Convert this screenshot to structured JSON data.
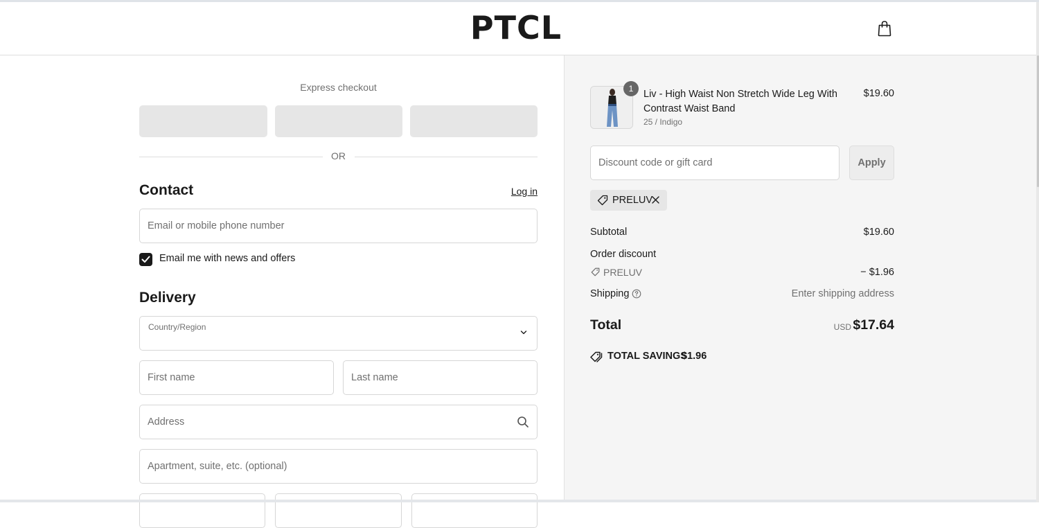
{
  "header": {
    "logo": "PTCL",
    "cart_icon": "shopping-bag-icon"
  },
  "express": {
    "label": "Express checkout",
    "or": "OR"
  },
  "contact": {
    "title": "Contact",
    "login": "Log in",
    "email_placeholder": "Email or mobile phone number",
    "newsletter_checked": true,
    "newsletter_label": "Email me with news and offers"
  },
  "delivery": {
    "title": "Delivery",
    "country_label": "Country/Region",
    "country_value": "",
    "first_name_placeholder": "First name",
    "last_name_placeholder": "Last name",
    "address_placeholder": "Address",
    "apartment_placeholder": "Apartment, suite, etc. (optional)"
  },
  "summary": {
    "item": {
      "quantity": "1",
      "name": "Liv - High Waist Non Stretch Wide Leg With Contrast Waist Band",
      "variant": "25 / Indigo",
      "price": "$19.60"
    },
    "discount_placeholder": "Discount code or gift card",
    "apply_label": "Apply",
    "applied_code": "PRELUV",
    "subtotal_label": "Subtotal",
    "subtotal_value": "$19.60",
    "order_discount_label": "Order discount",
    "discount_code": "PRELUV",
    "discount_value": "− $1.96",
    "shipping_label": "Shipping",
    "shipping_value": "Enter shipping address",
    "total_label": "Total",
    "currency": "USD",
    "total_value": "$17.64",
    "savings_label": "TOTAL SAVINGS",
    "savings_value": "$1.96"
  },
  "colors": {
    "text": "#1a1a1a",
    "muted": "#707070",
    "aside_bg": "#f5f5f5",
    "button_placeholder": "#e6e6e6"
  }
}
